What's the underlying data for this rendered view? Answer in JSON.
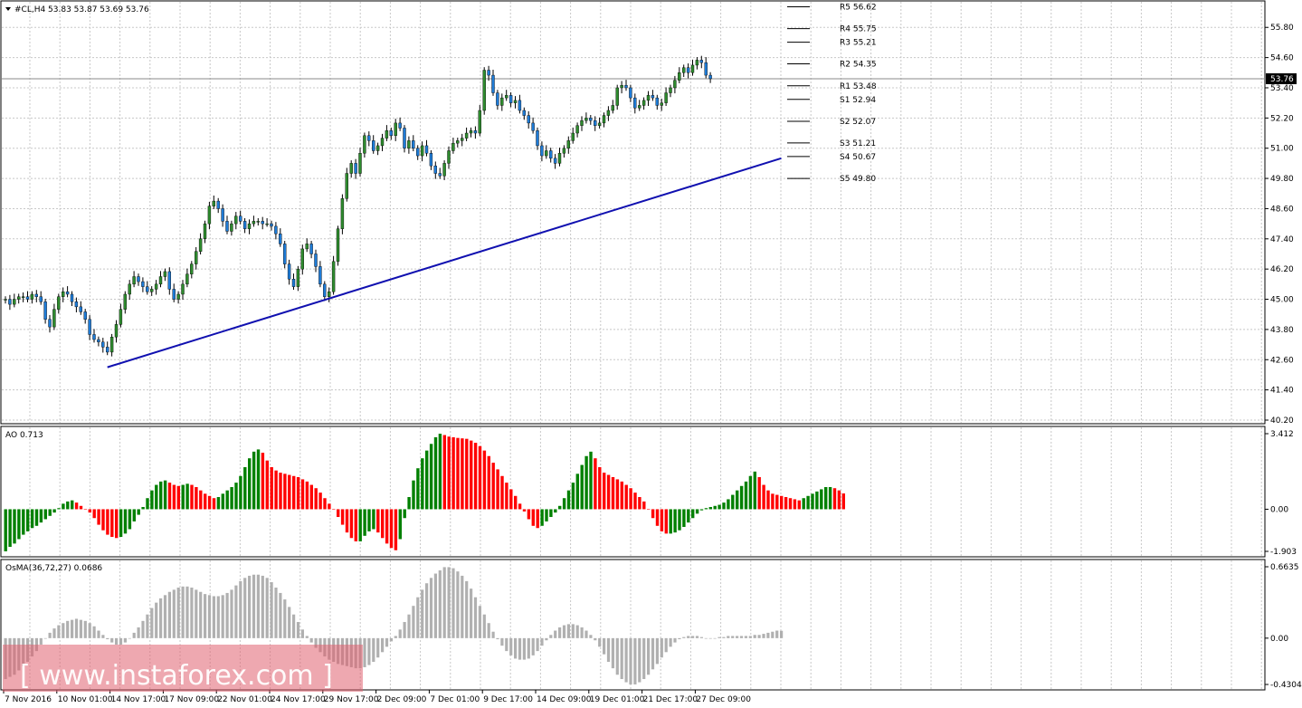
{
  "window": {
    "symbol_header": "#CL,H4  53.83 53.87 53.69 53.76",
    "last_price_tag": "53.76"
  },
  "watermark": {
    "text": "[ www.instaforex.com ]"
  },
  "colors": {
    "up_candle": "#2e8b2e",
    "down_candle": "#1e7bd6",
    "trendline": "#1010b0",
    "ao_up": "#008000",
    "ao_down": "#ff0000",
    "osma": "#b0b0b0",
    "grid": "#c8c8c8",
    "watermark_bg": "#e06070"
  },
  "chart_data": [
    {
      "type": "candlestick",
      "title": "#CL,H4  53.83 53.87 53.69 53.76",
      "ylim": [
        40.2,
        56.6
      ],
      "yticks": [
        "55.80",
        "54.60",
        "53.40",
        "52.20",
        "51.00",
        "49.80",
        "48.60",
        "47.40",
        "46.20",
        "45.00",
        "43.80",
        "42.60",
        "41.40",
        "40.20"
      ],
      "ytick_values": [
        55.8,
        54.6,
        53.4,
        52.2,
        51.0,
        49.8,
        48.6,
        47.4,
        46.2,
        45.0,
        43.8,
        42.6,
        41.4,
        40.2
      ],
      "last_price": 53.76,
      "pivot_levels": [
        {
          "label": "R5 56.62",
          "value": 56.62
        },
        {
          "label": "R4 55.75",
          "value": 55.75
        },
        {
          "label": "R3 55.21",
          "value": 55.21
        },
        {
          "label": "R2 54.35",
          "value": 54.35
        },
        {
          "label": "R1 53.48",
          "value": 53.48
        },
        {
          "label": "S1 52.94",
          "value": 52.94
        },
        {
          "label": "S2 52.07",
          "value": 52.07
        },
        {
          "label": "S3 51.21",
          "value": 51.21
        },
        {
          "label": "S4 50.67",
          "value": 50.67
        },
        {
          "label": "S5 49.80",
          "value": 49.8
        }
      ],
      "trendline": {
        "start_bar": 23,
        "start_value": 42.3,
        "end_bar": 175,
        "end_value": 50.6
      },
      "series": [
        {
          "points": [
            {
              "y": 45.0
            },
            {
              "y": 44.8
            },
            {
              "y": 45.0
            },
            {
              "y": 45.1
            },
            {
              "y": 45.1
            },
            {
              "y": 45.0
            },
            {
              "y": 45.2
            },
            {
              "y": 45.1
            },
            {
              "y": 44.9
            },
            {
              "y": 44.2
            },
            {
              "y": 43.9
            },
            {
              "y": 44.6
            },
            {
              "y": 45.1
            },
            {
              "y": 45.3
            },
            {
              "y": 45.2
            },
            {
              "y": 44.9
            },
            {
              "y": 44.7
            },
            {
              "y": 44.5
            },
            {
              "y": 44.2
            },
            {
              "y": 43.6
            },
            {
              "y": 43.4
            },
            {
              "y": 43.3
            },
            {
              "y": 43.1
            },
            {
              "y": 42.9
            },
            {
              "y": 43.5
            },
            {
              "y": 44.0
            },
            {
              "y": 44.6
            },
            {
              "y": 45.2
            },
            {
              "y": 45.6
            },
            {
              "y": 45.9
            },
            {
              "y": 45.7
            },
            {
              "y": 45.5
            },
            {
              "y": 45.3
            },
            {
              "y": 45.4
            },
            {
              "y": 45.6
            },
            {
              "y": 45.9
            },
            {
              "y": 46.1
            },
            {
              "y": 45.4
            },
            {
              "y": 45.0
            },
            {
              "y": 45.2
            },
            {
              "y": 45.6
            },
            {
              "y": 46.0
            },
            {
              "y": 46.4
            },
            {
              "y": 46.9
            },
            {
              "y": 47.4
            },
            {
              "y": 48.0
            },
            {
              "y": 48.7
            },
            {
              "y": 48.9
            },
            {
              "y": 48.6
            },
            {
              "y": 48.1
            },
            {
              "y": 47.7
            },
            {
              "y": 48.0
            },
            {
              "y": 48.3
            },
            {
              "y": 48.1
            },
            {
              "y": 47.8
            },
            {
              "y": 48.0
            },
            {
              "y": 48.1
            },
            {
              "y": 48.1
            },
            {
              "y": 48.0
            },
            {
              "y": 48.0
            },
            {
              "y": 47.9
            },
            {
              "y": 47.6
            },
            {
              "y": 47.2
            },
            {
              "y": 46.4
            },
            {
              "y": 45.8
            },
            {
              "y": 45.5
            },
            {
              "y": 46.2
            },
            {
              "y": 47.0
            },
            {
              "y": 47.2
            },
            {
              "y": 46.8
            },
            {
              "y": 46.3
            },
            {
              "y": 45.6
            },
            {
              "y": 45.1
            },
            {
              "y": 45.3
            },
            {
              "y": 46.5
            },
            {
              "y": 47.8
            },
            {
              "y": 49.0
            },
            {
              "y": 50.0
            },
            {
              "y": 50.4
            },
            {
              "y": 50.0
            },
            {
              "y": 50.8
            },
            {
              "y": 51.5
            },
            {
              "y": 51.3
            },
            {
              "y": 50.9
            },
            {
              "y": 51.1
            },
            {
              "y": 51.4
            },
            {
              "y": 51.7
            },
            {
              "y": 51.5
            },
            {
              "y": 52.0
            },
            {
              "y": 51.8
            },
            {
              "y": 51.0
            },
            {
              "y": 51.3
            },
            {
              "y": 51.0
            },
            {
              "y": 50.7
            },
            {
              "y": 51.1
            },
            {
              "y": 50.8
            },
            {
              "y": 50.3
            },
            {
              "y": 50.0
            },
            {
              "y": 49.9
            },
            {
              "y": 50.4
            },
            {
              "y": 50.9
            },
            {
              "y": 51.2
            },
            {
              "y": 51.3
            },
            {
              "y": 51.4
            },
            {
              "y": 51.6
            },
            {
              "y": 51.7
            },
            {
              "y": 51.6
            },
            {
              "y": 52.5
            },
            {
              "y": 54.1
            },
            {
              "y": 53.9
            },
            {
              "y": 53.2
            },
            {
              "y": 52.7
            },
            {
              "y": 53.0
            },
            {
              "y": 53.1
            },
            {
              "y": 52.8
            },
            {
              "y": 52.9
            },
            {
              "y": 52.5
            },
            {
              "y": 52.3
            },
            {
              "y": 52.0
            },
            {
              "y": 51.7
            },
            {
              "y": 51.1
            },
            {
              "y": 50.7
            },
            {
              "y": 50.9
            },
            {
              "y": 50.6
            },
            {
              "y": 50.4
            },
            {
              "y": 50.8
            },
            {
              "y": 51.0
            },
            {
              "y": 51.3
            },
            {
              "y": 51.6
            },
            {
              "y": 51.9
            },
            {
              "y": 52.1
            },
            {
              "y": 52.2
            },
            {
              "y": 52.1
            },
            {
              "y": 51.9
            },
            {
              "y": 52.0
            },
            {
              "y": 52.3
            },
            {
              "y": 52.5
            },
            {
              "y": 52.7
            },
            {
              "y": 53.4
            },
            {
              "y": 53.5
            },
            {
              "y": 53.4
            },
            {
              "y": 53.0
            },
            {
              "y": 52.6
            },
            {
              "y": 52.7
            },
            {
              "y": 52.9
            },
            {
              "y": 53.1
            },
            {
              "y": 53.0
            },
            {
              "y": 52.7
            },
            {
              "y": 52.8
            },
            {
              "y": 53.2
            },
            {
              "y": 53.4
            },
            {
              "y": 53.7
            },
            {
              "y": 54.0
            },
            {
              "y": 54.2
            },
            {
              "y": 54.0
            },
            {
              "y": 54.3
            },
            {
              "y": 54.5
            },
            {
              "y": 54.4
            },
            {
              "y": 53.9
            },
            {
              "y": 53.76
            }
          ]
        }
      ]
    },
    {
      "type": "bar",
      "title": "AO 0.713",
      "ylim": [
        -1.903,
        3.412
      ],
      "yticks": [
        "3.412",
        "0.00",
        "-1.903"
      ],
      "ytick_values": [
        3.412,
        0,
        -1.903
      ],
      "series": [
        {
          "name": "AO 0.713",
          "values": [
            -1.9,
            -1.7,
            -1.55,
            -1.35,
            -1.15,
            -1.0,
            -0.85,
            -0.75,
            -0.6,
            -0.45,
            -0.3,
            -0.15,
            0.05,
            0.25,
            0.35,
            0.4,
            0.3,
            0.15,
            0.0,
            -0.15,
            -0.4,
            -0.7,
            -0.95,
            -1.15,
            -1.25,
            -1.3,
            -1.25,
            -1.1,
            -0.9,
            -0.55,
            -0.25,
            0.1,
            0.5,
            0.85,
            1.1,
            1.25,
            1.3,
            1.2,
            1.1,
            1.05,
            1.1,
            1.15,
            1.1,
            1.0,
            0.85,
            0.7,
            0.6,
            0.5,
            0.55,
            0.7,
            0.85,
            1.0,
            1.2,
            1.5,
            1.9,
            2.3,
            2.6,
            2.7,
            2.55,
            2.2,
            1.9,
            1.75,
            1.65,
            1.6,
            1.55,
            1.5,
            1.45,
            1.35,
            1.25,
            1.1,
            0.95,
            0.75,
            0.5,
            0.25,
            0.0,
            -0.35,
            -0.7,
            -1.05,
            -1.3,
            -1.45,
            -1.45,
            -1.2,
            -1.0,
            -0.9,
            -1.05,
            -1.3,
            -1.55,
            -1.75,
            -1.85,
            -1.35,
            -0.4,
            0.55,
            1.3,
            1.85,
            2.3,
            2.65,
            2.95,
            3.25,
            3.41,
            3.35,
            3.28,
            3.25,
            3.22,
            3.2,
            3.18,
            3.1,
            3.0,
            2.85,
            2.65,
            2.4,
            2.1,
            1.8,
            1.5,
            1.2,
            0.9,
            0.6,
            0.25,
            -0.1,
            -0.45,
            -0.75,
            -0.85,
            -0.75,
            -0.55,
            -0.35,
            -0.15,
            0.15,
            0.5,
            0.85,
            1.2,
            1.6,
            2.0,
            2.4,
            2.6,
            2.3,
            1.9,
            1.65,
            1.55,
            1.45,
            1.35,
            1.25,
            1.1,
            0.95,
            0.75,
            0.55,
            0.35,
            0.0,
            -0.4,
            -0.75,
            -1.0,
            -1.1,
            -1.1,
            -1.05,
            -0.95,
            -0.8,
            -0.6,
            -0.4,
            -0.2,
            -0.05,
            0.05,
            0.1,
            0.15,
            0.2,
            0.3,
            0.45,
            0.65,
            0.85,
            1.05,
            1.25,
            1.5,
            1.7,
            1.45,
            1.1,
            0.85,
            0.7,
            0.65,
            0.6,
            0.55,
            0.5,
            0.45,
            0.4,
            0.5,
            0.6,
            0.7,
            0.8,
            0.9,
            1.0,
            1.0,
            0.95,
            0.85,
            0.713
          ]
        }
      ]
    },
    {
      "type": "bar",
      "title": "OsMA(36,72,27) 0.0686",
      "ylim": [
        -0.4304,
        0.6635
      ],
      "yticks": [
        "0.6635",
        "0.00",
        "-0.4304"
      ],
      "ytick_values": [
        0.6635,
        0,
        -0.4304
      ],
      "series": [
        {
          "name": "OsMA(36,72,27) 0.0686",
          "values": [
            -0.38,
            -0.36,
            -0.34,
            -0.3,
            -0.26,
            -0.22,
            -0.17,
            -0.12,
            -0.06,
            0.0,
            0.05,
            0.09,
            0.12,
            0.14,
            0.16,
            0.17,
            0.18,
            0.17,
            0.16,
            0.14,
            0.11,
            0.07,
            0.03,
            -0.01,
            -0.04,
            -0.06,
            -0.06,
            -0.04,
            0.0,
            0.05,
            0.1,
            0.16,
            0.22,
            0.28,
            0.33,
            0.37,
            0.4,
            0.43,
            0.45,
            0.47,
            0.48,
            0.48,
            0.47,
            0.45,
            0.43,
            0.41,
            0.4,
            0.39,
            0.39,
            0.4,
            0.42,
            0.45,
            0.49,
            0.53,
            0.56,
            0.58,
            0.59,
            0.59,
            0.58,
            0.56,
            0.52,
            0.47,
            0.42,
            0.36,
            0.29,
            0.22,
            0.15,
            0.08,
            0.02,
            -0.04,
            -0.09,
            -0.13,
            -0.17,
            -0.2,
            -0.22,
            -0.24,
            -0.25,
            -0.26,
            -0.27,
            -0.28,
            -0.28,
            -0.27,
            -0.25,
            -0.22,
            -0.18,
            -0.13,
            -0.08,
            -0.03,
            0.02,
            0.08,
            0.15,
            0.22,
            0.3,
            0.38,
            0.45,
            0.51,
            0.56,
            0.6,
            0.63,
            0.66,
            0.66,
            0.65,
            0.62,
            0.58,
            0.53,
            0.46,
            0.38,
            0.3,
            0.22,
            0.14,
            0.06,
            -0.01,
            -0.07,
            -0.12,
            -0.16,
            -0.19,
            -0.2,
            -0.2,
            -0.19,
            -0.16,
            -0.12,
            -0.07,
            -0.02,
            0.03,
            0.07,
            0.1,
            0.12,
            0.13,
            0.13,
            0.12,
            0.1,
            0.07,
            0.03,
            -0.02,
            -0.08,
            -0.15,
            -0.22,
            -0.28,
            -0.34,
            -0.38,
            -0.41,
            -0.43,
            -0.43,
            -0.41,
            -0.38,
            -0.34,
            -0.29,
            -0.24,
            -0.18,
            -0.13,
            -0.08,
            -0.04,
            -0.01,
            0.01,
            0.02,
            0.02,
            0.02,
            0.01,
            0.0,
            0.0,
            0.0,
            0.01,
            0.01,
            0.02,
            0.02,
            0.02,
            0.02,
            0.02,
            0.02,
            0.03,
            0.03,
            0.04,
            0.05,
            0.06,
            0.07,
            0.0686
          ]
        }
      ]
    }
  ],
  "x_axis": {
    "labels": [
      {
        "text": "7 Nov 2016",
        "bar": 0
      },
      {
        "text": "10 Nov 01:00",
        "bar": 12
      },
      {
        "text": "14 Nov 17:00",
        "bar": 24
      },
      {
        "text": "17 Nov 09:00",
        "bar": 36
      },
      {
        "text": "22 Nov 01:00",
        "bar": 48
      },
      {
        "text": "24 Nov 17:00",
        "bar": 60
      },
      {
        "text": "29 Nov 17:00",
        "bar": 72
      },
      {
        "text": "2 Dec 09:00",
        "bar": 84
      },
      {
        "text": "7 Dec 01:00",
        "bar": 96
      },
      {
        "text": "9 Dec 17:00",
        "bar": 108
      },
      {
        "text": "14 Dec 09:00",
        "bar": 120
      },
      {
        "text": "19 Dec 01:00",
        "bar": 132
      },
      {
        "text": "21 Dec 17:00",
        "bar": 144
      },
      {
        "text": "27 Dec 09:00",
        "bar": 156
      }
    ]
  }
}
